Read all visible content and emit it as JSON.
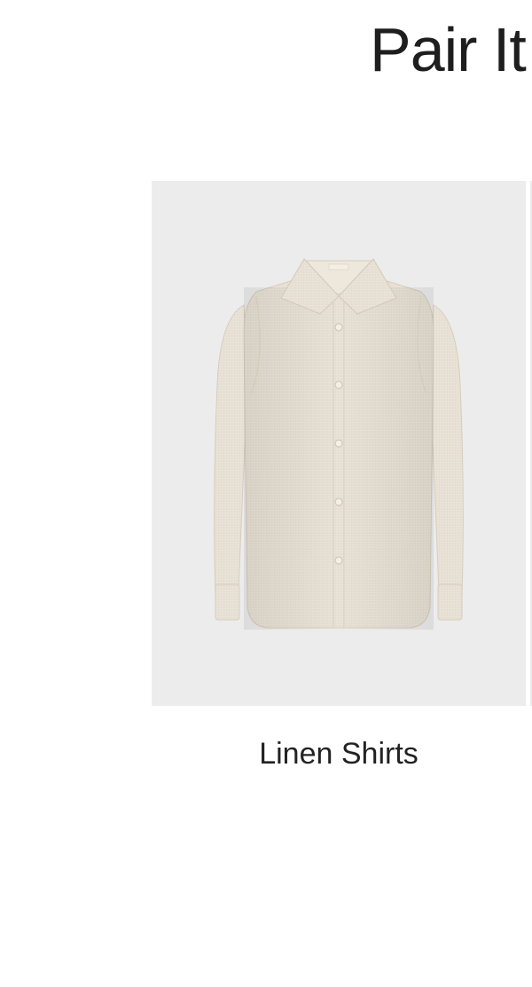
{
  "section": {
    "title": "Pair It"
  },
  "products": [
    {
      "label": "Linen Shirts",
      "icon": "linen-shirt-image",
      "colors": {
        "background": "#ececec",
        "fabric": "#e9e2d6"
      }
    }
  ]
}
